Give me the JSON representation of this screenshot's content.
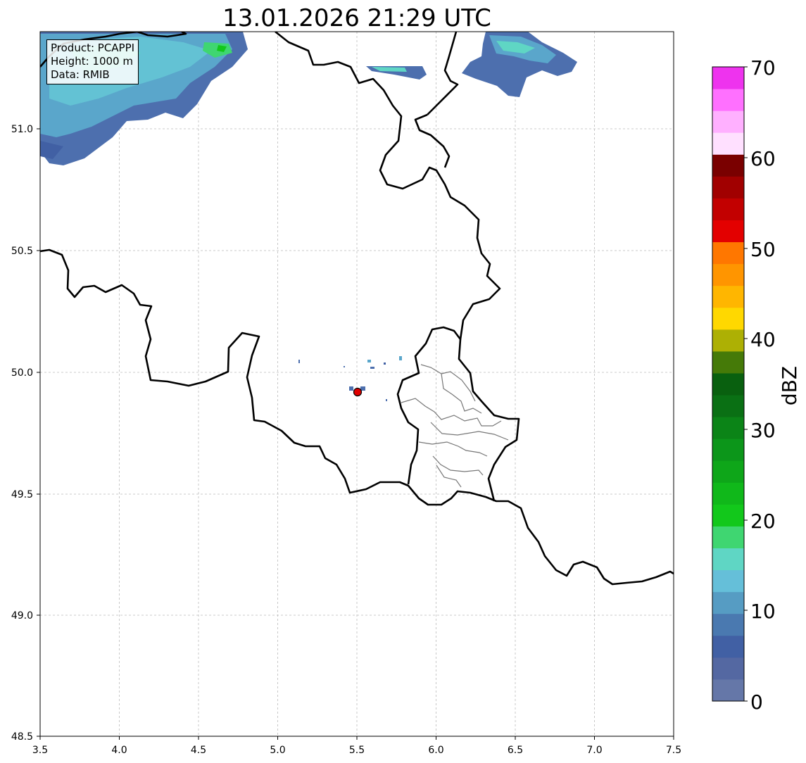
{
  "title": "13.01.2026 21:29 UTC",
  "info": {
    "product": "Product: PCAPPI",
    "height": "Height: 1000 m",
    "data": "Data: RMIB"
  },
  "axes": {
    "x_ticks": [
      "3.5",
      "4.0",
      "4.5",
      "5.0",
      "5.5",
      "6.0",
      "6.5",
      "7.0",
      "7.5"
    ],
    "y_ticks": [
      "48.5",
      "49.0",
      "49.5",
      "50.0",
      "50.5",
      "51.0"
    ],
    "lon_range": [
      3.5,
      7.5
    ],
    "lat_range": [
      48.5,
      51.42
    ],
    "grid": true
  },
  "colorbar": {
    "label": "dBZ",
    "ticks": [
      "0",
      "10",
      "20",
      "30",
      "40",
      "50",
      "60",
      "70"
    ],
    "min": 0,
    "max": 70,
    "step": 2.5,
    "colors": [
      "#6577a8",
      "#5468a2",
      "#4160a4",
      "#4a79b0",
      "#569cc3",
      "#65bfd9",
      "#5fd6c4",
      "#3fd671",
      "#12c81b",
      "#10b81a",
      "#0ea619",
      "#0c961a",
      "#0b8417",
      "#0a7014",
      "#09600f",
      "#457a08",
      "#adb004",
      "#ffd800",
      "#ffb600",
      "#ff9500",
      "#ff7700",
      "#e30000",
      "#c20000",
      "#a10000",
      "#7a0000",
      "#ffe0ff",
      "#ffb0ff",
      "#ff70ff",
      "#ee33ee"
    ]
  },
  "radar_site": {
    "lon": 5.505,
    "lat": 49.915,
    "color": "#e00000"
  },
  "colors": {
    "border": "#000000",
    "district_border": "#777777",
    "grid": "#bbbbbb"
  }
}
